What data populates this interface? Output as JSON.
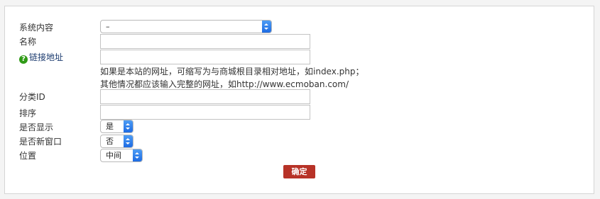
{
  "form": {
    "system_content": {
      "label": "系统内容",
      "value": "–"
    },
    "name": {
      "label": "名称",
      "value": ""
    },
    "link_address": {
      "label": "链接地址",
      "help_icon_symbol": "?",
      "value": "",
      "hint_line1": "如果是本站的网址，可缩写为与商城根目录相对地址，如index.php；",
      "hint_line2": "其他情况都应该输入完整的网址，如http://www.ecmoban.com/"
    },
    "category_id": {
      "label": "分类ID",
      "value": ""
    },
    "sort": {
      "label": "排序",
      "value": ""
    },
    "show": {
      "label": "是否显示",
      "value": "是"
    },
    "new_window": {
      "label": "是否新窗口",
      "value": "否"
    },
    "position": {
      "label": "位置",
      "value": "中间"
    },
    "confirm_label": "确定"
  },
  "icons": {
    "help": "help-icon",
    "select_arrows": "chevron-updown-icon"
  },
  "colors": {
    "help_icon": "#2f9a16",
    "select_arrows": "#1d6be3",
    "confirm_button": "#b73227",
    "link_label": "#1a3a6e"
  }
}
